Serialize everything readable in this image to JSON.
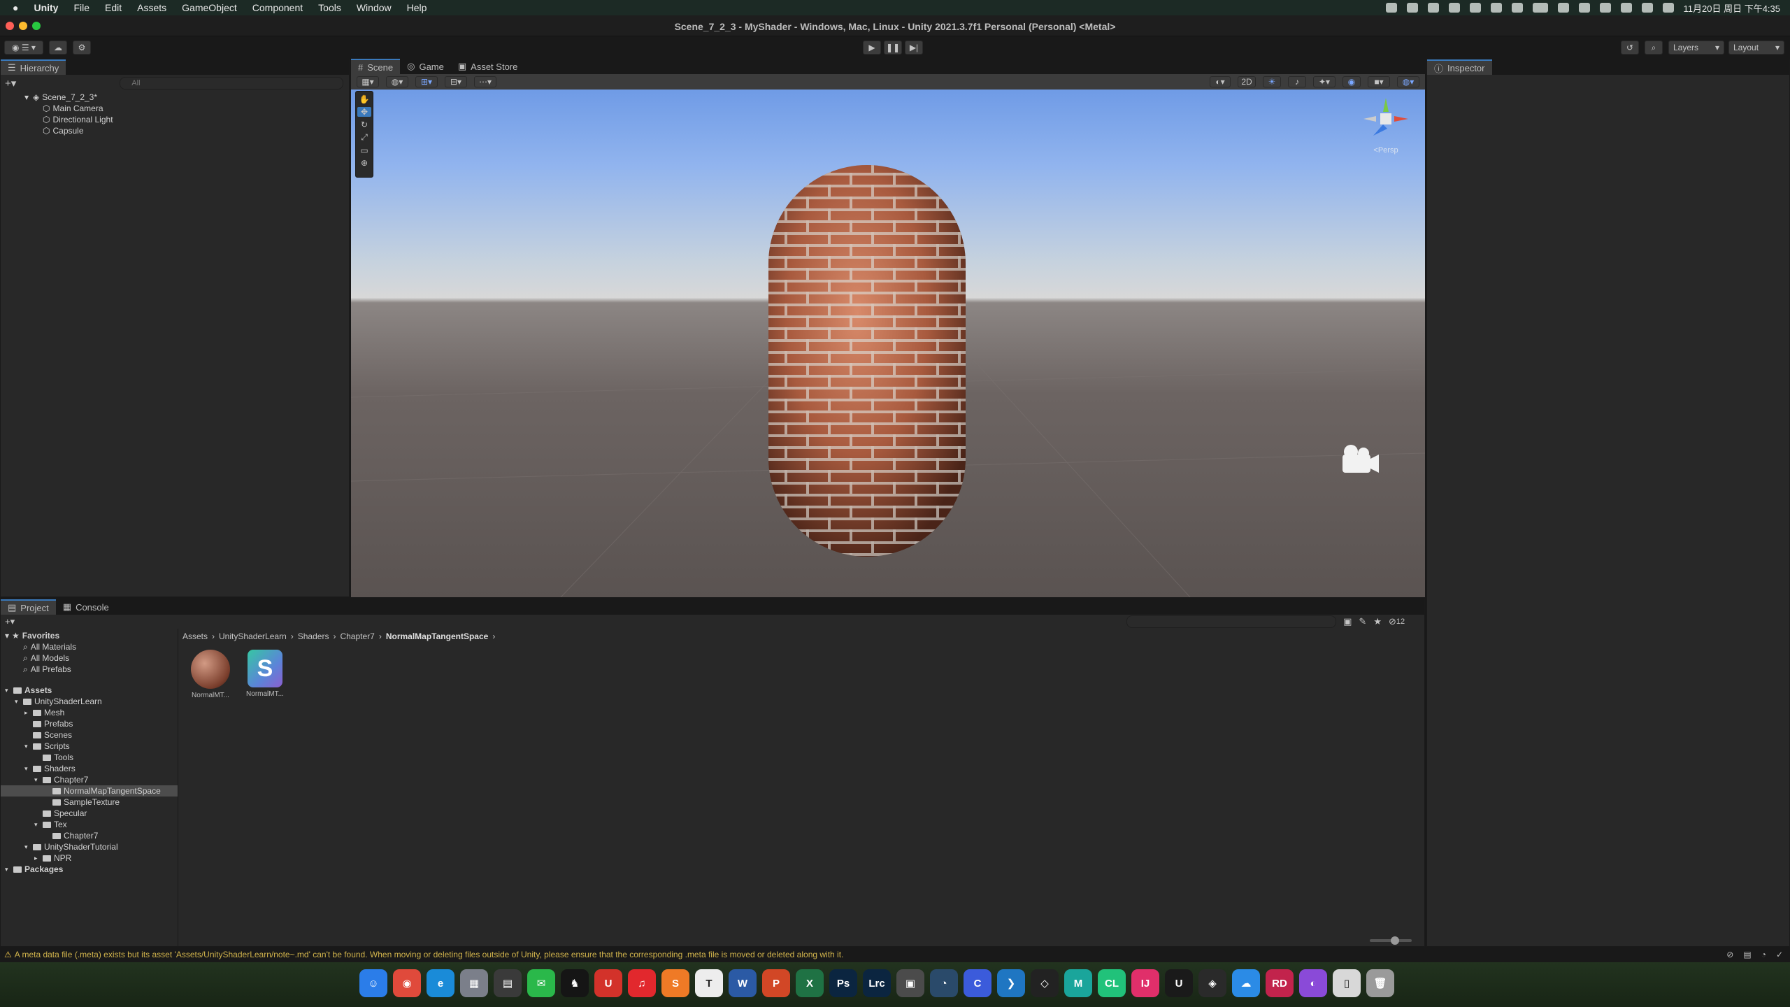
{
  "menubar": {
    "items": [
      "Unity",
      "File",
      "Edit",
      "Assets",
      "GameObject",
      "Component",
      "Tools",
      "Window",
      "Help"
    ],
    "clock": "11月20日 周日 下午4:35"
  },
  "window": {
    "title": "Scene_7_2_3 - MyShader - Windows, Mac, Linux - Unity 2021.3.7f1 Personal (Personal) <Metal>"
  },
  "toolbar": {
    "layers_label": "Layers",
    "layout_label": "Layout"
  },
  "hierarchy": {
    "tab_label": "Hierarchy",
    "search_placeholder": "All",
    "scene_name": "Scene_7_2_3*",
    "objects": [
      "Main Camera",
      "Directional Light",
      "Capsule"
    ]
  },
  "scene_view": {
    "tabs": [
      "Scene",
      "Game",
      "Asset Store"
    ],
    "mode_2d": "2D",
    "persp_label": "<Persp"
  },
  "inspector": {
    "tab_label": "Inspector"
  },
  "project": {
    "tabs": [
      "Project",
      "Console"
    ],
    "favorites_label": "Favorites",
    "favorites": [
      "All Materials",
      "All Models",
      "All Prefabs"
    ],
    "tree": [
      {
        "label": "Assets",
        "depth": 0,
        "bold": true
      },
      {
        "label": "UnityShaderLearn",
        "depth": 1
      },
      {
        "label": "Mesh",
        "depth": 2
      },
      {
        "label": "Prefabs",
        "depth": 2
      },
      {
        "label": "Scenes",
        "depth": 2
      },
      {
        "label": "Scripts",
        "depth": 2
      },
      {
        "label": "Tools",
        "depth": 3
      },
      {
        "label": "Shaders",
        "depth": 2
      },
      {
        "label": "Chapter7",
        "depth": 3
      },
      {
        "label": "NormalMapTangentSpace",
        "depth": 4,
        "selected": true
      },
      {
        "label": "SampleTexture",
        "depth": 4
      },
      {
        "label": "Specular",
        "depth": 3
      },
      {
        "label": "Tex",
        "depth": 3
      },
      {
        "label": "Chapter7",
        "depth": 4
      },
      {
        "label": "UnityShaderTutorial",
        "depth": 2
      },
      {
        "label": "NPR",
        "depth": 3
      },
      {
        "label": "Packages",
        "depth": 0,
        "bold": true
      }
    ],
    "breadcrumb": [
      "Assets",
      "UnityShaderLearn",
      "Shaders",
      "Chapter7",
      "NormalMapTangentSpace"
    ],
    "assets": [
      {
        "name": "NormalMT...",
        "kind": "material"
      },
      {
        "name": "NormalMT...",
        "kind": "shader"
      }
    ],
    "hidden_count": "12"
  },
  "status": {
    "message": "A meta data file (.meta) exists but its asset 'Assets/UnityShaderLearn/note~.md' can't be found. When moving or deleting files outside of Unity, please ensure that the corresponding .meta file is moved or deleted along with it."
  },
  "dock": {
    "apps": [
      {
        "name": "Finder",
        "color": "#2b7de9",
        "glyph": "☺"
      },
      {
        "name": "Chrome",
        "color": "#e04a3b",
        "glyph": "◉"
      },
      {
        "name": "Edge",
        "color": "#1a8bd8",
        "glyph": "e"
      },
      {
        "name": "Launchpad",
        "color": "#7b7f8a",
        "glyph": "▦"
      },
      {
        "name": "Notes",
        "color": "#3a3a3a",
        "glyph": "▤"
      },
      {
        "name": "WeChat",
        "color": "#2ab84a",
        "glyph": "✉"
      },
      {
        "name": "QQ",
        "color": "#151515",
        "glyph": "♞"
      },
      {
        "name": "Uno",
        "color": "#d3322a",
        "glyph": "U"
      },
      {
        "name": "NetEase Music",
        "color": "#e2282d",
        "glyph": "♫"
      },
      {
        "name": "Sublime",
        "color": "#ef7a26",
        "glyph": "S"
      },
      {
        "name": "Typora",
        "color": "#ededed",
        "glyph": "T"
      },
      {
        "name": "Word",
        "color": "#2b5aa5",
        "glyph": "W"
      },
      {
        "name": "PowerPoint",
        "color": "#d24726",
        "glyph": "P"
      },
      {
        "name": "Excel",
        "color": "#1f7244",
        "glyph": "X"
      },
      {
        "name": "Photoshop",
        "color": "#0b2540",
        "glyph": "Ps"
      },
      {
        "name": "Lightroom",
        "color": "#0b2540",
        "glyph": "Lrc"
      },
      {
        "name": "Final Cut",
        "color": "#4b4b4b",
        "glyph": "▣"
      },
      {
        "name": "DaVinci",
        "color": "#2a4a6a",
        "glyph": "◔"
      },
      {
        "name": "Cursor",
        "color": "#3b5bdb",
        "glyph": "C"
      },
      {
        "name": "VS Code",
        "color": "#1f76c2",
        "glyph": "❯"
      },
      {
        "name": "Unity Hub",
        "color": "#222222",
        "glyph": "◇"
      },
      {
        "name": "Maya",
        "color": "#1aa59b",
        "glyph": "M"
      },
      {
        "name": "CLion",
        "color": "#21c27a",
        "glyph": "CL"
      },
      {
        "name": "IntelliJ",
        "color": "#e02f6a",
        "glyph": "IJ"
      },
      {
        "name": "Unreal",
        "color": "#1a1a1a",
        "glyph": "U"
      },
      {
        "name": "Unity",
        "color": "#2a2a2a",
        "glyph": "◈"
      },
      {
        "name": "Cloud",
        "color": "#2b8be6",
        "glyph": "☁"
      },
      {
        "name": "Rider",
        "color": "#c2234c",
        "glyph": "RD"
      },
      {
        "name": "GitHub",
        "color": "#8a4ad8",
        "glyph": "◐"
      },
      {
        "name": "Files",
        "color": "#d8d8d8",
        "glyph": "▯"
      },
      {
        "name": "Trash",
        "color": "#9a9a9a",
        "glyph": "🗑"
      }
    ]
  }
}
